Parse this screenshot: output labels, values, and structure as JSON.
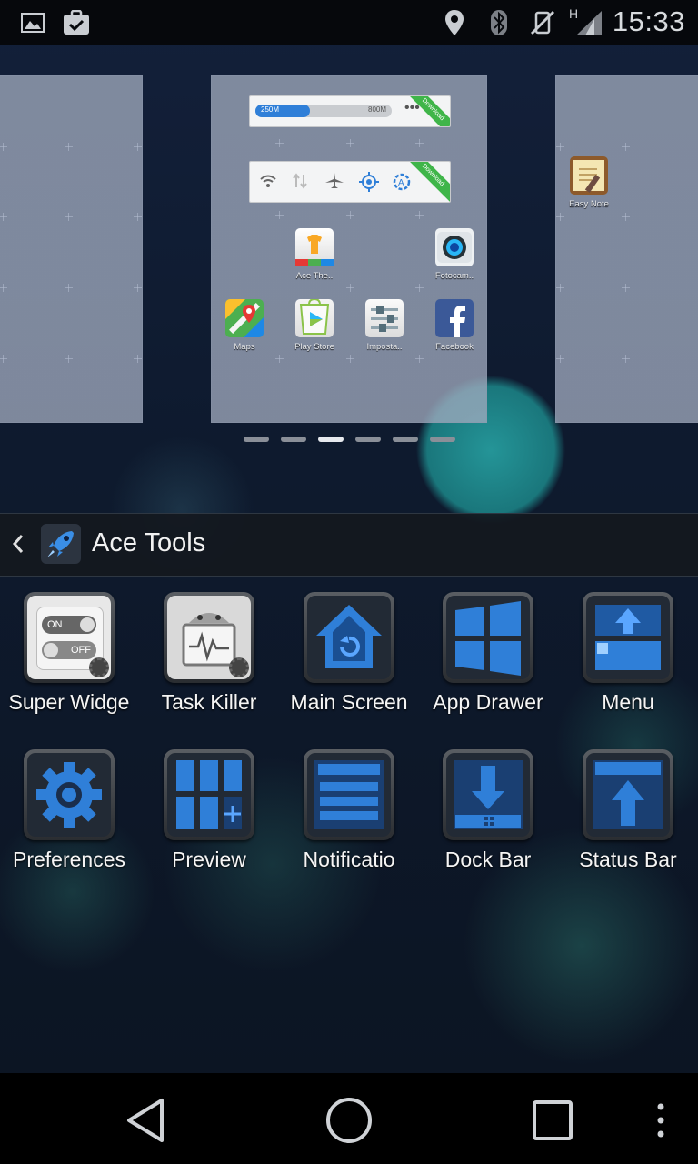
{
  "status_bar": {
    "time": "15:33",
    "network_label": "H",
    "icons": [
      "image-icon",
      "clipboard-check-icon",
      "location-icon",
      "bluetooth-icon",
      "mute-icon",
      "signal-icon"
    ]
  },
  "home_preview": {
    "widget_memory": {
      "used": "250M",
      "total": "800M",
      "ribbon": "Download"
    },
    "widget_toggles": {
      "ribbon": "Download"
    },
    "apps_center": [
      {
        "label": "Ace The..",
        "icon": "ace-theme-icon"
      },
      {
        "label": "Fotocam..",
        "icon": "camera-icon"
      },
      {
        "label": "Maps",
        "icon": "maps-icon"
      },
      {
        "label": "Play Store",
        "icon": "play-store-icon"
      },
      {
        "label": "Imposta..",
        "icon": "settings-sliders-icon"
      },
      {
        "label": "Facebook",
        "icon": "facebook-icon"
      }
    ],
    "apps_right": [
      {
        "label": "Easy Note",
        "icon": "note-icon"
      }
    ],
    "page_count": 6,
    "active_page": 3
  },
  "folder": {
    "title": "Ace Tools",
    "items": [
      {
        "label": "Super Widge",
        "icon": "toggle-switch-icon"
      },
      {
        "label": "Task Killer",
        "icon": "android-monitor-icon"
      },
      {
        "label": "Main Screen",
        "icon": "home-icon"
      },
      {
        "label": "App Drawer",
        "icon": "windows-grid-icon"
      },
      {
        "label": "Menu",
        "icon": "menu-upload-icon"
      },
      {
        "label": "Preferences",
        "icon": "gear-icon"
      },
      {
        "label": "Preview",
        "icon": "preview-grid-icon"
      },
      {
        "label": "Notificatio",
        "icon": "notification-list-icon"
      },
      {
        "label": "Dock Bar",
        "icon": "dock-download-icon"
      },
      {
        "label": "Status Bar",
        "icon": "status-upload-icon"
      }
    ],
    "toggle_on": "ON",
    "toggle_off": "OFF"
  },
  "colors": {
    "accent": "#2f7fd8",
    "status_bg": "#06080c",
    "nav_bg": "#000000"
  }
}
